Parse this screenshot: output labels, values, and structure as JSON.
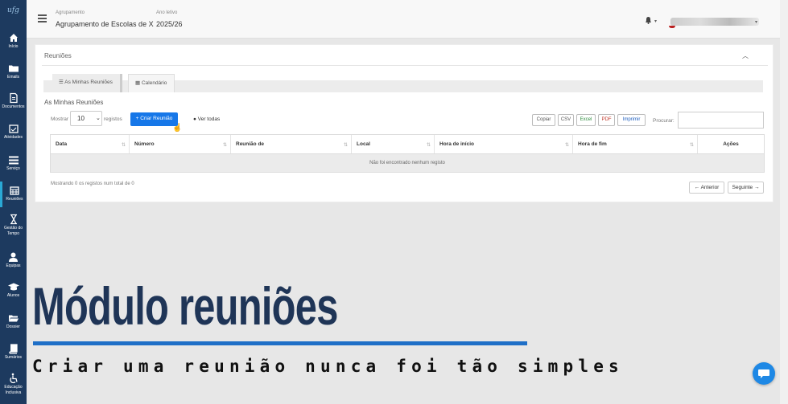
{
  "brand": {
    "logo_text": "ufg"
  },
  "sidebar": {
    "items": [
      {
        "label": "Início",
        "icon": "home-icon"
      },
      {
        "label": "Emails",
        "icon": "folder-icon"
      },
      {
        "label": "Documentos",
        "icon": "document-icon"
      },
      {
        "label": "Atividades",
        "icon": "calendar-check-icon"
      },
      {
        "label": "Serviço",
        "icon": "list-icon"
      },
      {
        "label": "Reuniões",
        "icon": "calendar-icon",
        "active": true
      },
      {
        "label": "Gestão do Tempo",
        "icon": "hourglass-icon"
      },
      {
        "label": "Equipas",
        "icon": "user-icon"
      },
      {
        "label": "Alunos",
        "icon": "graduation-cap-icon"
      },
      {
        "label": "Dossier",
        "icon": "folder-open-icon"
      },
      {
        "label": "Sumários",
        "icon": "book-icon"
      },
      {
        "label": "Educação Inclusiva",
        "icon": "wheelchair-icon"
      }
    ]
  },
  "header": {
    "agrupamento_label": "Agrupamento",
    "agrupamento_value": "Agrupamento de Escolas de X",
    "ano_label": "Ano letivo",
    "ano_value": "2025/26"
  },
  "panel": {
    "title": "Reuniões",
    "tabs": [
      {
        "label": "As Minhas Reuniões"
      },
      {
        "label": "Calendário"
      }
    ],
    "subtitle": "As Minhas Reuniões"
  },
  "controls": {
    "mostrar_label": "Mostrar",
    "page_size": "10",
    "registos_label": "registos",
    "criar_label": "+ Criar Reunião",
    "ver_todas_label": "Ver todas",
    "procurar_label": "Procurar:",
    "export_buttons": [
      {
        "label": "Copiar",
        "color": "#555555"
      },
      {
        "label": "CSV",
        "color": "#555555"
      },
      {
        "label": "Excel",
        "color": "#2e8b3e"
      },
      {
        "label": "PDF",
        "color": "#c0392b"
      },
      {
        "label": "Imprimir",
        "color": "#1f5fbf"
      }
    ]
  },
  "table": {
    "columns": [
      "Data",
      "Número",
      "Reunião de",
      "Local",
      "Hora de início",
      "Hora de fim",
      "Ações"
    ],
    "empty_text": "Não foi encontrado nenhum registo",
    "info_text": "Mostrando 0 os registos num total de 0",
    "prev_label": "← Anterior",
    "next_label": "Seguinte →"
  },
  "overlay": {
    "headline": "Módulo reuniões",
    "tagline": "Criar uma reunião nunca foi tão simples"
  },
  "colors": {
    "sidebar": "#1d3a5f",
    "primary": "#1677e8",
    "headline": "#1f3557",
    "underline": "#1f6fc7"
  }
}
